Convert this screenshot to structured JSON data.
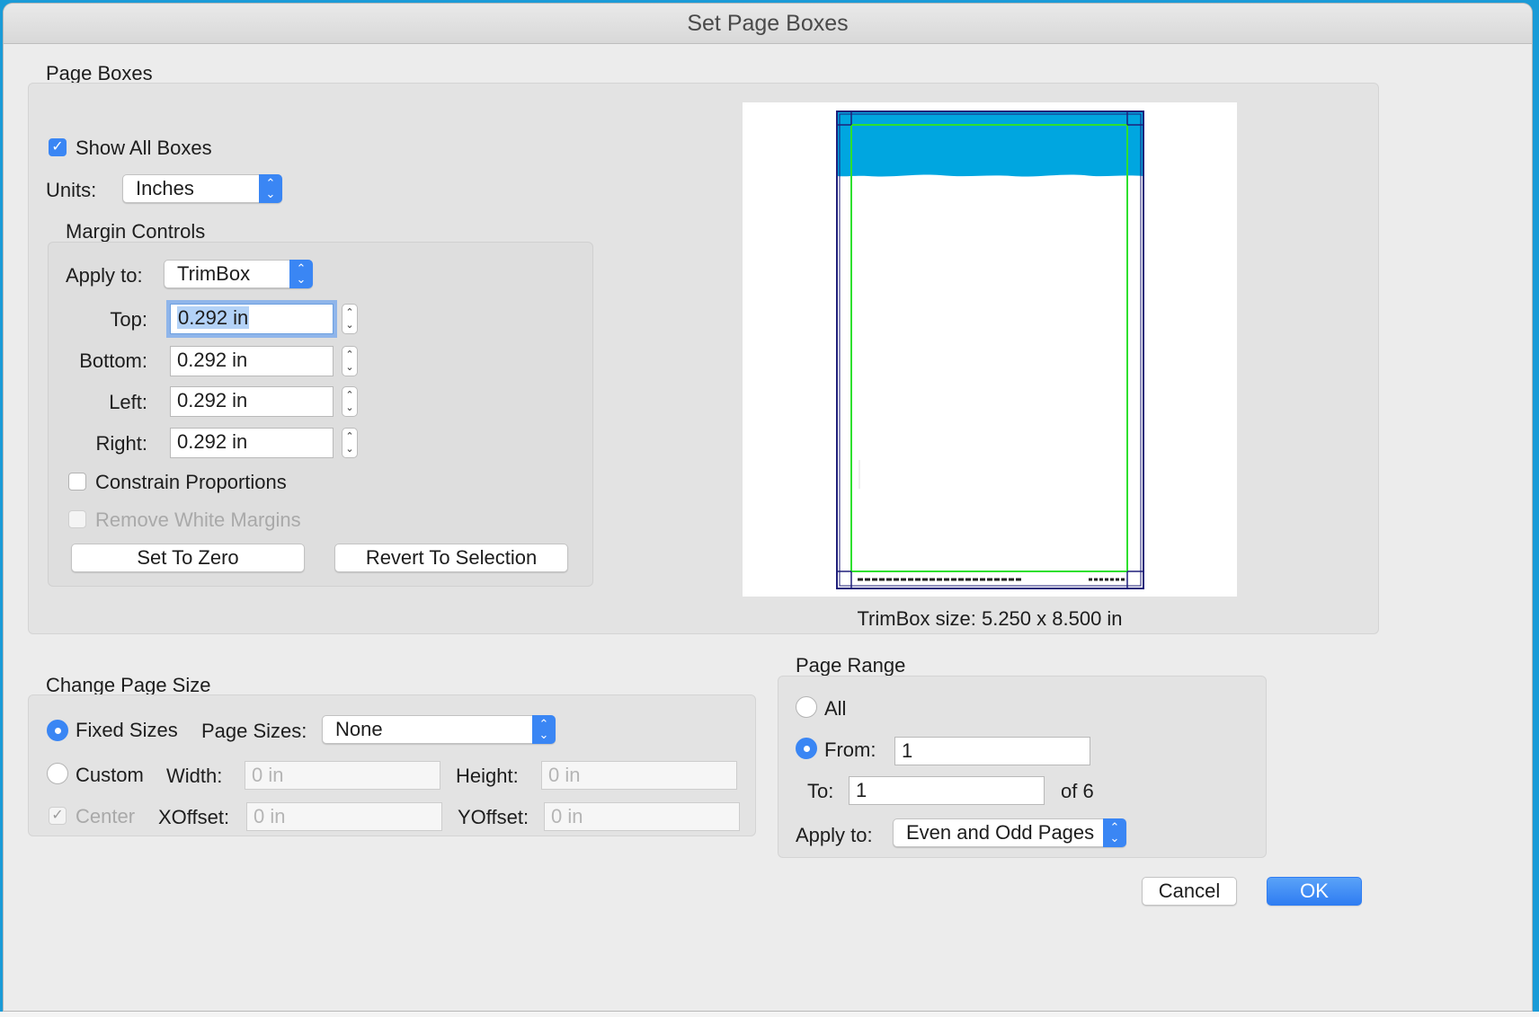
{
  "dialog": {
    "title": "Set Page Boxes"
  },
  "page_boxes": {
    "section_label": "Page Boxes",
    "show_all_boxes": {
      "label": "Show All Boxes",
      "checked": true
    },
    "units": {
      "label": "Units:",
      "value": "Inches"
    },
    "margin_controls": {
      "section_label": "Margin Controls",
      "apply_to": {
        "label": "Apply to:",
        "value": "TrimBox"
      },
      "top": {
        "label": "Top:",
        "value": "0.292 in"
      },
      "bottom": {
        "label": "Bottom:",
        "value": "0.292 in"
      },
      "left": {
        "label": "Left:",
        "value": "0.292 in"
      },
      "right": {
        "label": "Right:",
        "value": "0.292 in"
      },
      "constrain_proportions": {
        "label": "Constrain Proportions",
        "checked": false
      },
      "remove_white_margins": {
        "label": "Remove White Margins",
        "checked": false,
        "disabled": true
      },
      "set_to_zero": "Set To Zero",
      "revert_to_selection": "Revert To Selection"
    },
    "preview": {
      "trimbox_size": "TrimBox size: 5.250 x 8.500 in",
      "colors": {
        "mediabox": "#1f1f7a",
        "trimbox": "#2ee02e",
        "header": "#00a6e0"
      }
    }
  },
  "change_page_size": {
    "section_label": "Change Page Size",
    "fixed_sizes": {
      "label": "Fixed Sizes",
      "selected": true
    },
    "page_sizes": {
      "label": "Page Sizes:",
      "value": "None"
    },
    "custom": {
      "label": "Custom",
      "selected": false
    },
    "width": {
      "label": "Width:",
      "placeholder": "0 in"
    },
    "height": {
      "label": "Height:",
      "placeholder": "0 in"
    },
    "center": {
      "label": "Center",
      "checked": true,
      "disabled": true
    },
    "xoffset": {
      "label": "XOffset:",
      "placeholder": "0 in"
    },
    "yoffset": {
      "label": "YOffset:",
      "placeholder": "0 in"
    }
  },
  "page_range": {
    "section_label": "Page Range",
    "all": {
      "label": "All",
      "selected": false
    },
    "from": {
      "label": "From:",
      "value": "1",
      "selected": true
    },
    "to": {
      "label": "To:",
      "value": "1"
    },
    "of_total": "of 6",
    "apply_to": {
      "label": "Apply to:",
      "value": "Even and Odd Pages"
    }
  },
  "buttons": {
    "cancel": "Cancel",
    "ok": "OK"
  },
  "colors": {
    "accent": "#3a86f4",
    "desktop": "#1a9bd7"
  }
}
